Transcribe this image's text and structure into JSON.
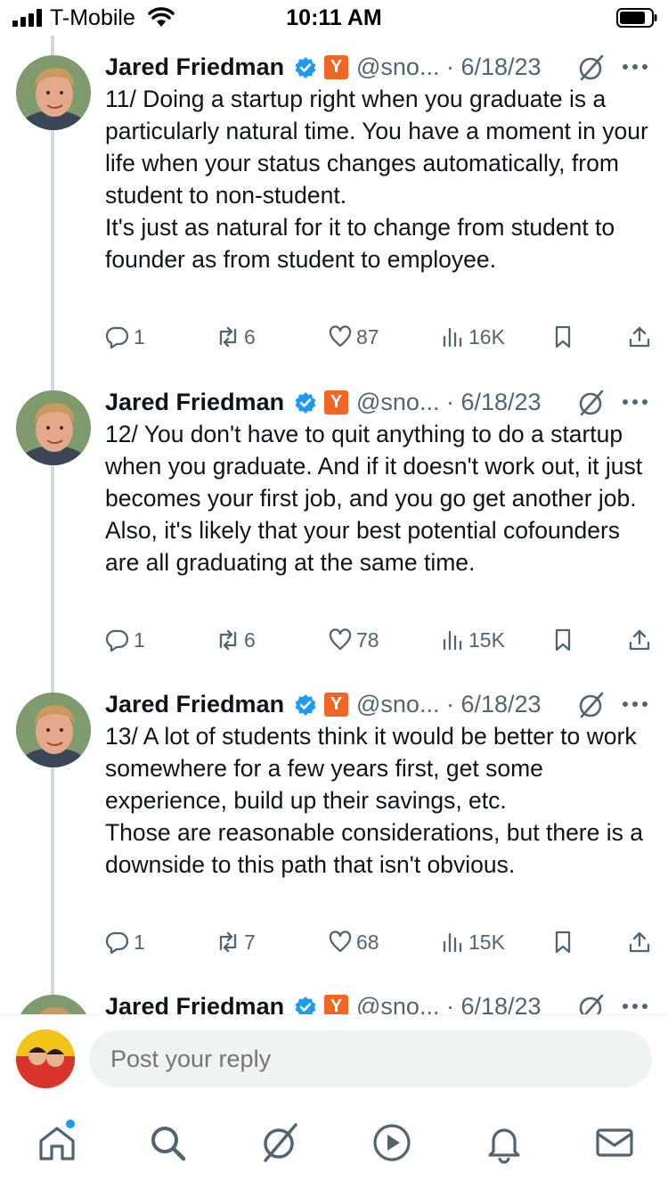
{
  "status_bar": {
    "carrier": "T-Mobile",
    "time": "10:11 AM"
  },
  "tweets": [
    {
      "name": "Jared Friedman",
      "badge": "Y",
      "handle": "@sno...",
      "date": "· 6/18/23",
      "text": "11/ Doing a startup right when you graduate is a particularly natural time.  You have a moment in your life when your status changes automatically, from student to non-student.\n It's just as natural for it to change from student to founder as from student to employee.",
      "replies": "1",
      "retweets": "6",
      "likes": "87",
      "views": "16K"
    },
    {
      "name": "Jared Friedman",
      "badge": "Y",
      "handle": "@sno...",
      "date": "· 6/18/23",
      "text": "12/ You don't have to quit anything to do a startup when you graduate.  And if it doesn't work out, it just becomes your first job, and you go get another job.  Also, it's likely that your best potential cofounders are all graduating at the same time.",
      "replies": "1",
      "retweets": "6",
      "likes": "78",
      "views": "15K"
    },
    {
      "name": "Jared Friedman",
      "badge": "Y",
      "handle": "@sno...",
      "date": "· 6/18/23",
      "text": "13/ A lot of students think it would be better to work somewhere for a few years first, get some experience, build up their savings, etc.\n Those are reasonable considerations, but there is a downside to this path that isn't obvious.",
      "replies": "1",
      "retweets": "7",
      "likes": "68",
      "views": "15K"
    },
    {
      "name": "Jared Friedman",
      "badge": "Y",
      "handle": "@sno...",
      "date": "· 6/18/23"
    }
  ],
  "reply": {
    "placeholder": "Post your reply"
  },
  "tabs": [
    "home-icon",
    "search-icon",
    "grok-icon",
    "video-icon",
    "notifications-icon",
    "messages-icon"
  ],
  "colors": {
    "accent": "#1d9bf0",
    "yc_orange": "#f26522",
    "muted_text": "#536471",
    "thread_line": "#cfd9de"
  }
}
